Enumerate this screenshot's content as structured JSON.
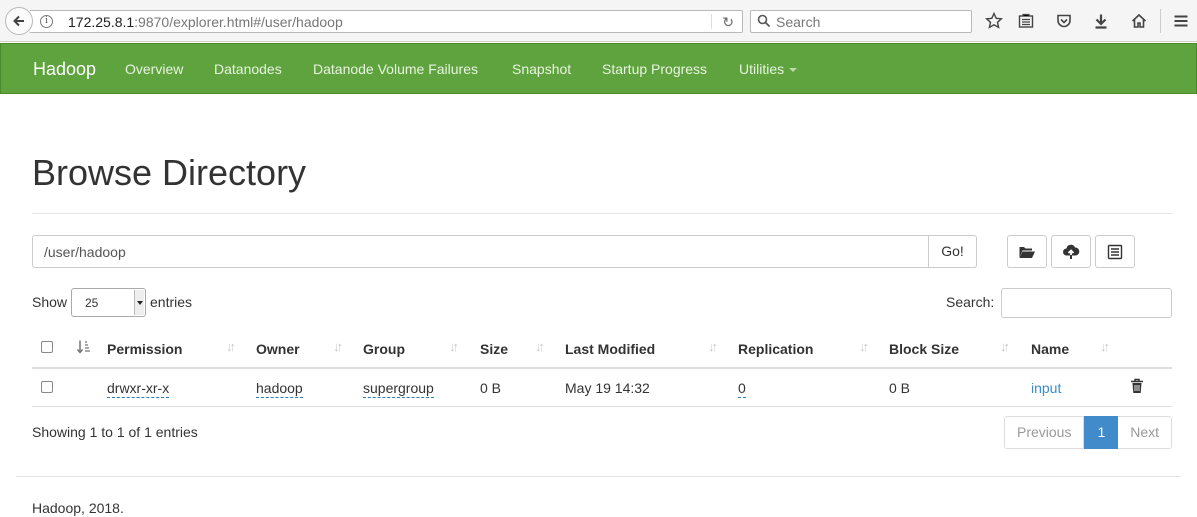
{
  "browser": {
    "url_host": "172.25.8.1",
    "url_rest": ":9870/explorer.html#/user/hadoop",
    "search_placeholder": "Search"
  },
  "navbar": {
    "brand": "Hadoop",
    "items": [
      "Overview",
      "Datanodes",
      "Datanode Volume Failures",
      "Snapshot",
      "Startup Progress",
      "Utilities"
    ]
  },
  "page": {
    "title": "Browse Directory",
    "path_value": "/user/hadoop",
    "go_label": "Go!"
  },
  "table_controls": {
    "show_label": "Show",
    "page_length": "25",
    "entries_label": "entries",
    "search_label": "Search:"
  },
  "table": {
    "columns": [
      "Permission",
      "Owner",
      "Group",
      "Size",
      "Last Modified",
      "Replication",
      "Block Size",
      "Name"
    ],
    "rows": [
      {
        "permission": "drwxr-xr-x",
        "owner": "hadoop",
        "group": "supergroup",
        "size": "0 B",
        "last_modified": "May 19 14:32",
        "replication": "0",
        "block_size": "0 B",
        "name": "input"
      }
    ]
  },
  "pagination": {
    "info": "Showing 1 to 1 of 1 entries",
    "previous": "Previous",
    "current": "1",
    "next": "Next"
  },
  "footer": {
    "text": "Hadoop, 2018."
  },
  "colors": {
    "navbar": "#5fa33e",
    "link": "#3a8dcc",
    "pager_active": "#428bca"
  }
}
